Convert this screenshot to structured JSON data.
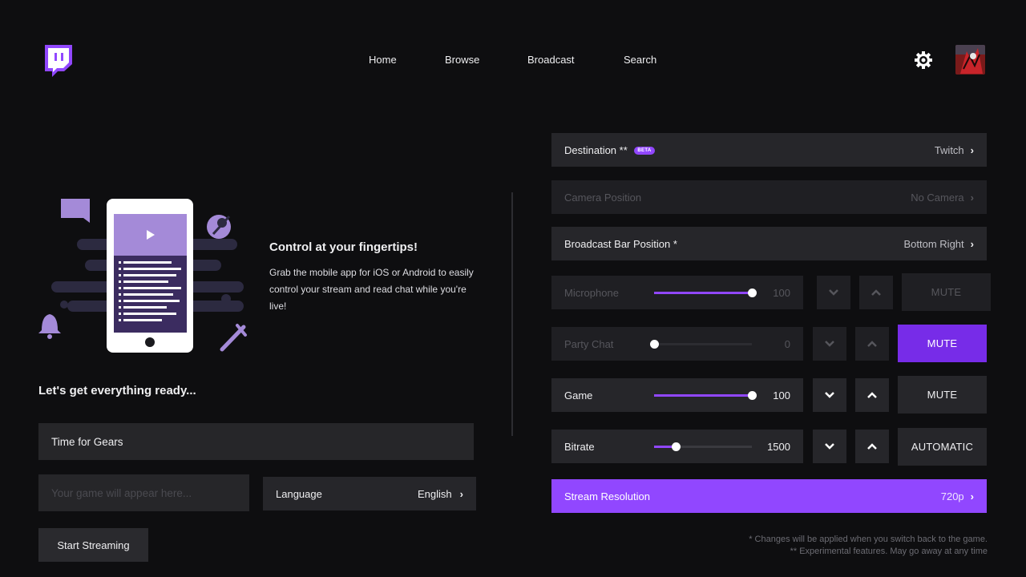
{
  "header": {
    "nav": [
      "Home",
      "Browse",
      "Broadcast",
      "Search"
    ],
    "icons": {
      "logo": "twitch-logo",
      "settings": "gear-icon",
      "avatar": "user-avatar"
    }
  },
  "promo": {
    "title": "Control at your fingertips!",
    "body": "Grab the mobile app for iOS or Android to easily control your stream and read chat while you're live!"
  },
  "setup": {
    "heading": "Let's get everything ready...",
    "stream_title": "Time for Gears",
    "game_placeholder": "Your game will appear here...",
    "language_label": "Language",
    "language_value": "English",
    "start_label": "Start Streaming"
  },
  "settings": {
    "destination": {
      "label": "Destination **",
      "badge": "BETA",
      "value": "Twitch"
    },
    "camera": {
      "label": "Camera Position",
      "value": "No Camera"
    },
    "bar_position": {
      "label": "Broadcast Bar Position *",
      "value": "Bottom Right"
    },
    "microphone": {
      "label": "Microphone",
      "value": "100",
      "level": 100,
      "button": "MUTE"
    },
    "party_chat": {
      "label": "Party Chat",
      "value": "0",
      "level": 0,
      "button": "MUTE"
    },
    "game": {
      "label": "Game",
      "value": "100",
      "level": 100,
      "button": "MUTE"
    },
    "bitrate": {
      "label": "Bitrate",
      "value": "1500",
      "level": 22,
      "button": "AUTOMATIC"
    },
    "resolution": {
      "label": "Stream Resolution",
      "value": "720p"
    }
  },
  "notes": {
    "line1": "* Changes will be applied when you switch back to the game.",
    "line2": "** Experimental features. May go away at any time"
  },
  "colors": {
    "accent": "#9147ff",
    "accent_dark": "#772ce8",
    "background": "#0e0e10",
    "panel": "#26262a"
  }
}
